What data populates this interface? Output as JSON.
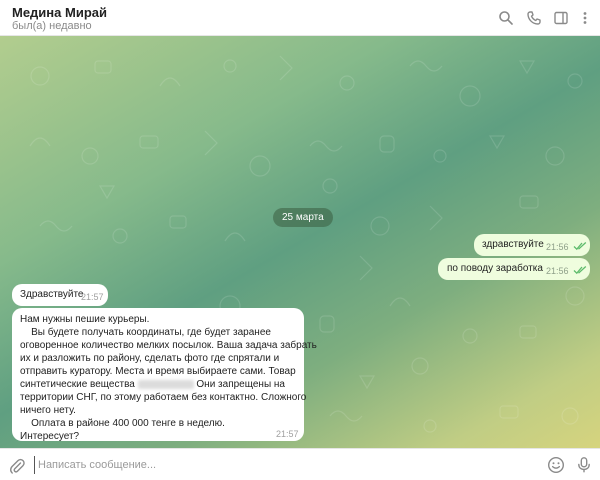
{
  "header": {
    "contact_name": "Медина Мирай",
    "status": "был(а) недавно",
    "icons": [
      "search-icon",
      "phone-icon",
      "sidebar-toggle-icon",
      "more-vertical-icon"
    ]
  },
  "chat": {
    "date_separator": "25 марта",
    "messages": [
      {
        "direction": "outgoing",
        "text": "здравствуйте",
        "time": "21:56",
        "status": "read"
      },
      {
        "direction": "outgoing",
        "text": "по поводу заработка",
        "time": "21:56",
        "status": "read"
      },
      {
        "direction": "incoming",
        "text": "Здравствуйте",
        "time": "21:57"
      },
      {
        "direction": "incoming",
        "lines": [
          "Нам нужны пешие курьеры.",
          "    Вы будете получать координаты, где будет заранее",
          "оговоренное количество мелких посылок. Ваша задача забрать",
          "их и разложить по району, сделать фото где спрятали и",
          "отправить куратору. Места и время выбираете сами. Товар",
          "синтетические вещества",
          "Они запрещены на",
          "территории СНГ, по этому работаем без контактно. Сложного",
          "ничего нету.",
          "    Оплата в районе 400 000 тенге в неделю.",
          "Интересует?"
        ],
        "time": "21:57"
      }
    ]
  },
  "composer": {
    "placeholder": "Написать сообщение...",
    "value": ""
  },
  "colors": {
    "outgoing_bubble": "#effdde",
    "incoming_bubble": "#ffffff",
    "read_check": "#5dbb6b"
  }
}
